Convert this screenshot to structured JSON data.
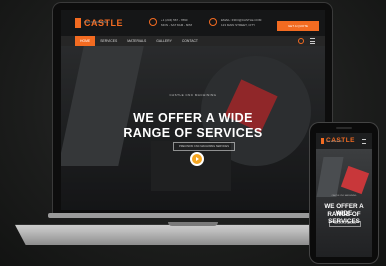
{
  "site": {
    "logo_text": "CASTLE",
    "logo_subtitle": "CNC MACHINING"
  },
  "header": {
    "phone_label": "+1 (234) 567 - 7890",
    "phone_sub": "MON - SAT 8AM - 6PM",
    "email_label": "EMAIL: INFO@CASTLE.COM",
    "email_sub": "123 MAIN STREET, CITY",
    "cta_label": "GET A QUOTE"
  },
  "nav": {
    "items": [
      {
        "label": "HOME"
      },
      {
        "label": "SERVICES"
      },
      {
        "label": "MATERIALS"
      },
      {
        "label": "GALLERY"
      },
      {
        "label": "CONTACT"
      }
    ]
  },
  "hero": {
    "eyebrow": "CASTLE CNC MACHINING",
    "title_line1": "WE OFFER A WIDE",
    "title_line2": "RANGE OF SERVICES",
    "subtitle": "PRECISION CNC MACHINING SERVICES"
  },
  "mobile": {
    "logo_text": "CASTLE",
    "logo_subtitle": "CNC MACHINING",
    "eyebrow": "CASTLE CNC MACHINING",
    "title_line1": "WE OFFER A WIDE",
    "title_line2": "RANGE OF SERVICES",
    "subtitle": "PRECISION CNC MACHINING"
  },
  "colors": {
    "accent": "#f36b21",
    "background": "#1c1d1c"
  }
}
